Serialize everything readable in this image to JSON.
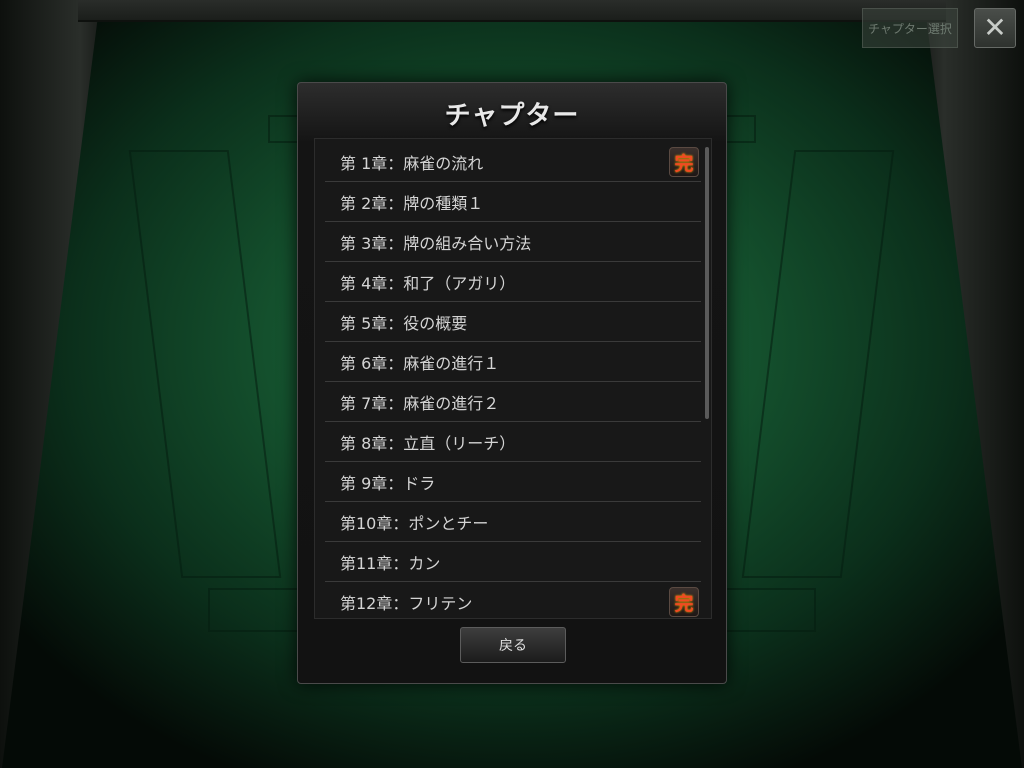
{
  "header": {
    "chapter_select_label": "チャプター選択",
    "close_icon": "close-icon"
  },
  "dialog": {
    "title": "チャプター",
    "chapters": [
      {
        "label": "第 1章：麻雀の流れ",
        "complete": true
      },
      {
        "label": "第 2章：牌の種類１",
        "complete": false
      },
      {
        "label": "第 3章：牌の組み合い方法",
        "complete": false
      },
      {
        "label": "第 4章：和了（アガリ）",
        "complete": false
      },
      {
        "label": "第 5章：役の概要",
        "complete": false
      },
      {
        "label": "第 6章：麻雀の進行１",
        "complete": false
      },
      {
        "label": "第 7章：麻雀の進行２",
        "complete": false
      },
      {
        "label": "第 8章：立直（リーチ）",
        "complete": false
      },
      {
        "label": "第 9章：ドラ",
        "complete": false
      },
      {
        "label": "第10章：ポンとチー",
        "complete": false
      },
      {
        "label": "第11章：カン",
        "complete": false
      },
      {
        "label": "第12章：フリテン",
        "complete": true
      }
    ],
    "complete_badge": "完",
    "back_label": "戻る"
  },
  "colors": {
    "felt": "#1e6b3e",
    "badge_text": "#f04a22",
    "dialog_bg": "#141414"
  }
}
